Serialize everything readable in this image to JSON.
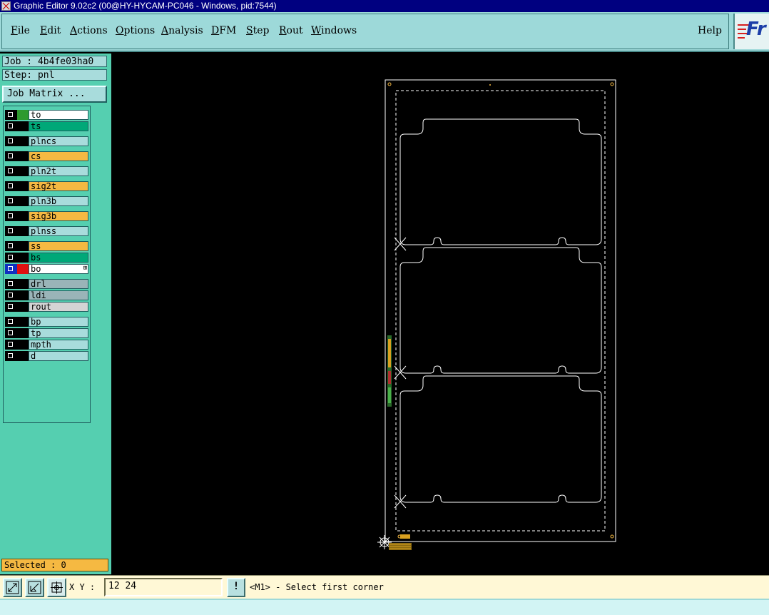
{
  "window": {
    "title": "Graphic Editor 9.02c2 (00@HY-HYCAM-PC046 - Windows, pid:7544)"
  },
  "menu": {
    "items": [
      {
        "prefix": "",
        "ul": "F",
        "rest": "ile"
      },
      {
        "prefix": "",
        "ul": "E",
        "rest": "dit"
      },
      {
        "prefix": "",
        "ul": "A",
        "rest": "ctions"
      },
      {
        "prefix": "",
        "ul": "O",
        "rest": "ptions"
      },
      {
        "prefix": "",
        "ul": "A",
        "rest": "nalysis"
      },
      {
        "prefix": "",
        "ul": "D",
        "rest": "FM"
      },
      {
        "prefix": "",
        "ul": "S",
        "rest": "tep"
      },
      {
        "prefix": "",
        "ul": "R",
        "rest": "out"
      },
      {
        "prefix": "",
        "ul": "W",
        "rest": "indows"
      }
    ],
    "help": "Help"
  },
  "logo": {
    "text": "Fr"
  },
  "job": {
    "label": "Job : 4b4fe03ha0"
  },
  "step": {
    "label": "Step: pnl"
  },
  "job_matrix": {
    "label": "Job Matrix ..."
  },
  "layers": [
    {
      "name": "to",
      "bg": "#ffffff",
      "swatch": "#2e9a2e"
    },
    {
      "name": "ts",
      "bg": "#00a878",
      "swatch": "#000000"
    },
    {
      "name": "plncs",
      "bg": "#a8dcdc",
      "swatch": "#000000"
    },
    {
      "name": "cs",
      "bg": "#f5b942",
      "swatch": "#000000"
    },
    {
      "name": "pln2t",
      "bg": "#a8dcdc",
      "swatch": "#000000"
    },
    {
      "name": "sig2t",
      "bg": "#f5b942",
      "swatch": "#000000"
    },
    {
      "name": "pln3b",
      "bg": "#a8dcdc",
      "swatch": "#000000"
    },
    {
      "name": "sig3b",
      "bg": "#f5b942",
      "swatch": "#000000"
    },
    {
      "name": "plnss",
      "bg": "#a8dcdc",
      "swatch": "#000000"
    },
    {
      "name": "ss",
      "bg": "#f5b942",
      "swatch": "#000000"
    },
    {
      "name": "bs",
      "bg": "#00a878",
      "swatch": "#000000"
    },
    {
      "name": "bo",
      "bg": "#ffffff",
      "swatch": "#e01010",
      "active": true
    },
    {
      "name": "drl",
      "bg": "#9ab4b8",
      "swatch": "#000000"
    },
    {
      "name": "ldi",
      "bg": "#9ab4b8",
      "swatch": "#000000"
    },
    {
      "name": "rout",
      "bg": "#d4d4d4",
      "swatch": "#000000"
    },
    {
      "name": "bp",
      "bg": "#a8dcdc",
      "swatch": "#000000"
    },
    {
      "name": "tp",
      "bg": "#a8dcdc",
      "swatch": "#000000"
    },
    {
      "name": "mpth",
      "bg": "#a8dcdc",
      "swatch": "#000000"
    },
    {
      "name": "d",
      "bg": "#a8dcdc",
      "swatch": "#000000"
    }
  ],
  "selected": {
    "label": "Selected : 0"
  },
  "coords": {
    "label": "X Y :",
    "value": "12 24"
  },
  "prompt": {
    "text": "<M1> - Select first corner"
  },
  "excl_button": {
    "label": "!"
  },
  "colors": {
    "menubar": "#9dd9d9",
    "panel": "#55cfb0",
    "canvas": "#000000",
    "outline": "#ffffff"
  }
}
